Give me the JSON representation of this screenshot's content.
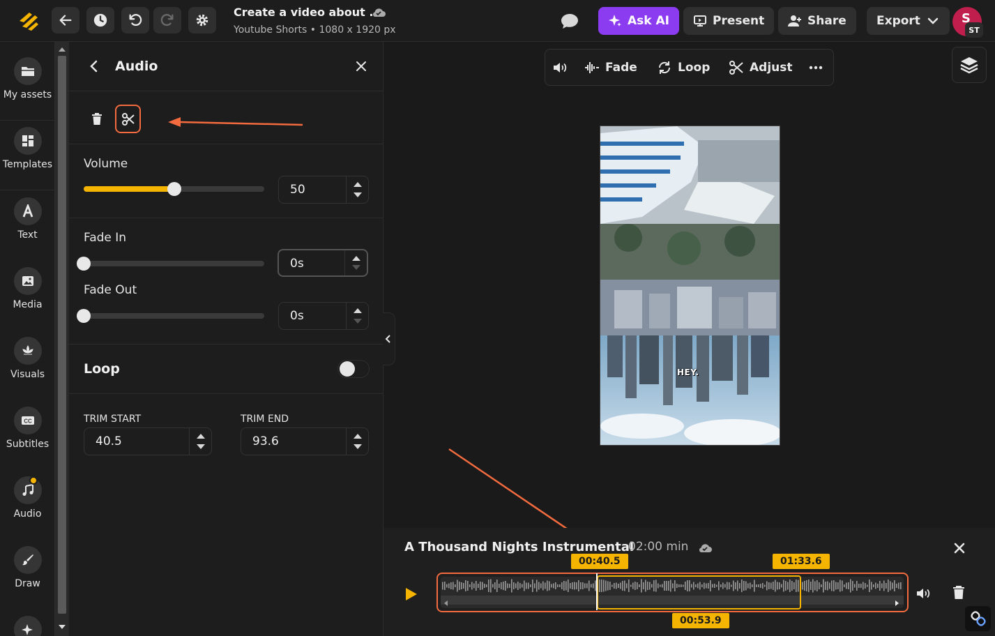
{
  "header": {
    "title": "Create a video about ...",
    "subtitle": "Youtube Shorts • 1080 x 1920 px",
    "ask_ai": "Ask AI",
    "present": "Present",
    "share": "Share",
    "export": "Export",
    "avatar_initial": "S",
    "avatar_badge": "ST"
  },
  "nav": {
    "items": [
      {
        "label": "My assets",
        "icon": "folder-icon"
      },
      {
        "label": "Templates",
        "icon": "templates-icon"
      },
      {
        "label": "Text",
        "icon": "text-icon"
      },
      {
        "label": "Media",
        "icon": "image-icon"
      },
      {
        "label": "Visuals",
        "icon": "visuals-icon"
      },
      {
        "label": "Subtitles",
        "icon": "cc-icon"
      },
      {
        "label": "Audio",
        "icon": "music-icon"
      },
      {
        "label": "Draw",
        "icon": "brush-icon"
      }
    ]
  },
  "panel": {
    "title": "Audio",
    "volume_label": "Volume",
    "volume_value": "50",
    "volume_level": 0.5,
    "fade_in_label": "Fade In",
    "fade_in_value": "0s",
    "fade_out_label": "Fade Out",
    "fade_out_value": "0s",
    "loop_label": "Loop",
    "loop_on": false,
    "trim_start_label": "TRIM START",
    "trim_start_value": "40.5",
    "trim_end_label": "TRIM END",
    "trim_end_value": "93.6"
  },
  "toolbar": {
    "fade": "Fade",
    "loop": "Loop",
    "adjust": "Adjust"
  },
  "preview": {
    "caption": "HEY."
  },
  "timeline": {
    "track_title": "A Thousand Nights Instrumental",
    "duration": "02:00 min",
    "start_tag": "00:40.5",
    "end_tag": "01:33.6",
    "length_tag": "00:53.9"
  },
  "colors": {
    "accent": "#f5b400",
    "annotation": "#f36b3e",
    "ai": "#8b3cf0",
    "avatar": "#c01f4d"
  }
}
